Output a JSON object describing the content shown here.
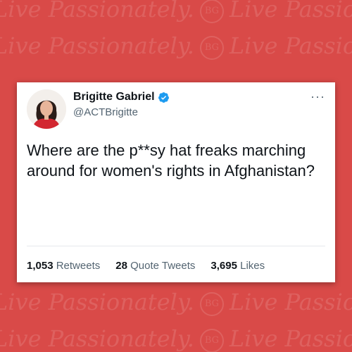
{
  "watermark": {
    "text": "Live Passionately.",
    "seal": "BG"
  },
  "tweet": {
    "author_name": "Brigitte Gabriel",
    "handle": "@ACTBrigitte",
    "verified": true,
    "more_label": "···",
    "text": "Where are the p**sy hat freaks marching around for women's rights in Afghanistan?",
    "stats": {
      "retweets_count": "1,053",
      "retweets_label": "Retweets",
      "quotes_count": "28",
      "quotes_label": "Quote Tweets",
      "likes_count": "3,695",
      "likes_label": "Likes"
    }
  },
  "colors": {
    "background": "#d94a48",
    "verified_badge": "#1d9bf0"
  }
}
